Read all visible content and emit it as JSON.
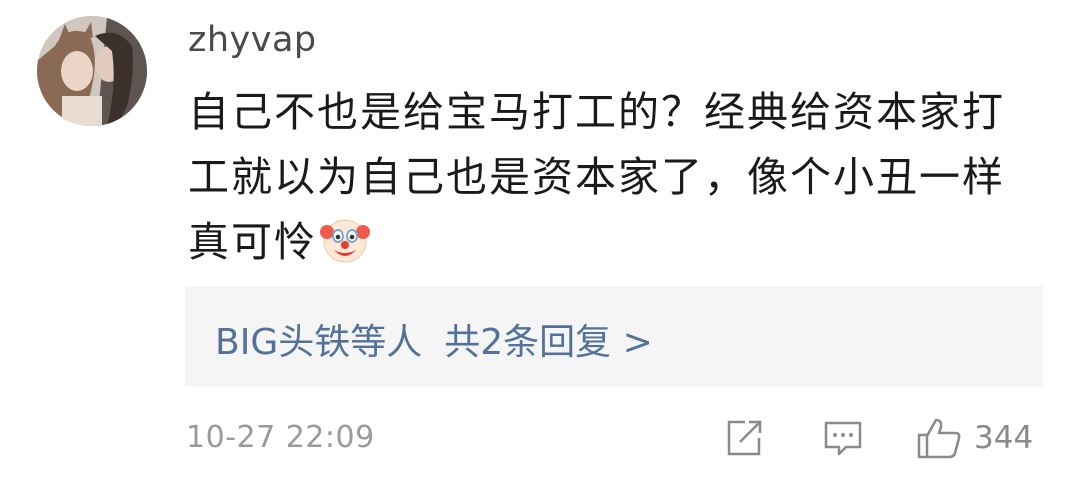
{
  "comment": {
    "username": "zhyvap",
    "content_lines": [
      "自己不也是给宝马打工的？经典给资本家打",
      "工就以为自己也是资本家了，像个小丑一样",
      "真可怜"
    ],
    "emoji": "clown-face-emoji",
    "reply_summary": {
      "users": "BIG头铁等人",
      "count_text": "共2条回复 >"
    },
    "timestamp": "10-27 22:09",
    "actions": {
      "share_icon": "share-icon",
      "comment_icon": "comment-icon",
      "like_icon": "thumbs-up-icon",
      "like_count": "344"
    }
  },
  "colors": {
    "link": "#53729b",
    "text": "#1a1a1a",
    "muted": "#9a9a9a",
    "reply_bg": "#f5f5f5"
  }
}
